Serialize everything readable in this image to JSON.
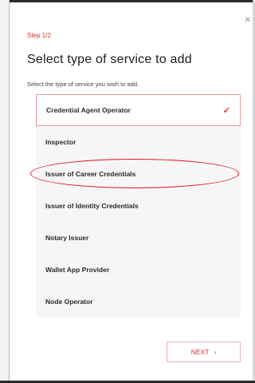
{
  "dialog": {
    "close_symbol": "×",
    "step_label": "Step 1/2",
    "title": "Select type of service to add",
    "subtitle": "Select the type of service you wish to add."
  },
  "options": [
    {
      "label": "Credential Agent Operator",
      "selected": true
    },
    {
      "label": "Inspector",
      "selected": false
    },
    {
      "label": "Issuer of Career Credentials",
      "selected": false,
      "annotated": true
    },
    {
      "label": "Issuer of Identity Credentials",
      "selected": false
    },
    {
      "label": "Notary Issuer",
      "selected": false
    },
    {
      "label": "Wallet App Provider",
      "selected": false
    },
    {
      "label": "Node Operator",
      "selected": false
    }
  ],
  "selected_mark": "✓",
  "next_button": {
    "label": "NEXT",
    "chevron": "›"
  },
  "colors": {
    "accent": "#d9322b",
    "annotation": "#e0141f",
    "option_bg": "#f6f6f6"
  },
  "icons": {
    "close": "close-icon",
    "check": "check-icon",
    "next": "chevron-right-icon"
  }
}
